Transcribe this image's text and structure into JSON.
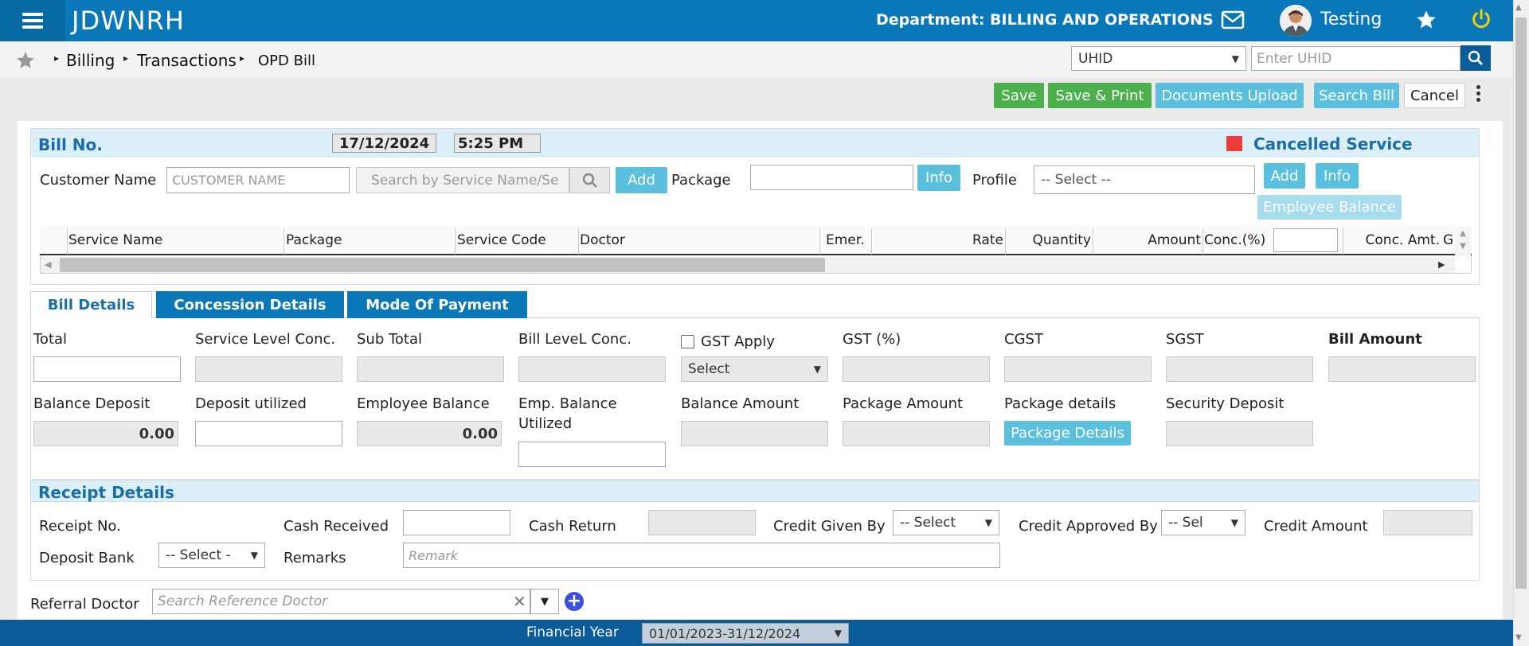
{
  "app": {
    "brand": "JDWNRH",
    "department_label": "Department: BILLING AND OPERATIONS",
    "user_name": "Testing"
  },
  "breadcrumb": {
    "items": [
      "Billing",
      "Transactions",
      "OPD Bill"
    ]
  },
  "search": {
    "type_selected": "UHID",
    "placeholder": "Enter UHID"
  },
  "actions": {
    "save": "Save",
    "save_print": "Save & Print",
    "documents_upload": "Documents Upload",
    "search_bill": "Search Bill",
    "cancel": "Cancel"
  },
  "bill_header": {
    "title": "Bill No.",
    "date": "17/12/2024",
    "time": "5:25 PM",
    "legend_label": "Cancelled Service",
    "legend_color": "#ee3b3b"
  },
  "customer_row": {
    "customer_label": "Customer Name",
    "customer_placeholder": "CUSTOMER NAME",
    "service_placeholder": "Search by Service Name/Se",
    "add_label": "Add",
    "package_label": "Package",
    "package_value": "",
    "info_label": "Info",
    "profile_label": "Profile",
    "profile_selected": "-- Select --",
    "add2_label": "Add",
    "info2_label": "Info",
    "employee_balance_label": "Employee Balance"
  },
  "services_table": {
    "columns": [
      "Service Name",
      "Package",
      "Service Code",
      "Doctor",
      "Emer.",
      "Rate",
      "Quantity",
      "Amount",
      "Conc.(%)",
      "Conc. Amt.",
      "G"
    ],
    "conc_input_value": ""
  },
  "tabs": [
    {
      "label": "Bill Details",
      "active": true
    },
    {
      "label": "Concession Details",
      "active": false
    },
    {
      "label": "Mode Of Payment",
      "active": false
    }
  ],
  "bill_details": {
    "total": "Total",
    "service_level_conc": "Service Level Conc.",
    "sub_total": "Sub Total",
    "bill_level_conc": "Bill LeveL Conc.",
    "gst_apply": "GST Apply",
    "gst_select": "Select",
    "gst_pct": "GST (%)",
    "cgst": "CGST",
    "sgst": "SGST",
    "bill_amount": "Bill Amount",
    "balance_deposit": "Balance Deposit",
    "balance_deposit_value": "0.00",
    "deposit_utilized": "Deposit utilized",
    "employee_balance": "Employee Balance",
    "employee_balance_value": "0.00",
    "emp_balance_utilized_1": "Emp. Balance",
    "emp_balance_utilized_2": "Utilized",
    "balance_amount": "Balance Amount",
    "package_amount": "Package Amount",
    "package_details": "Package details",
    "package_details_btn": "Package Details",
    "security_deposit": "Security Deposit"
  },
  "receipt": {
    "title": "Receipt Details",
    "receipt_no": "Receipt No.",
    "cash_received": "Cash Received",
    "cash_return": "Cash Return",
    "credit_given_by": "Credit Given By",
    "credit_given_select": "-- Select",
    "credit_approved_by": "Credit Approved By",
    "credit_approved_select": "-- Sel",
    "credit_amount": "Credit Amount",
    "deposit_bank": "Deposit Bank",
    "deposit_bank_select": "-- Select -",
    "remarks": "Remarks",
    "remarks_placeholder": "Remark"
  },
  "referral": {
    "label": "Referral Doctor",
    "placeholder": "Search Reference Doctor"
  },
  "footer": {
    "label": "Financial Year",
    "value": "01/01/2023-31/12/2024"
  },
  "colors": {
    "header_blue": "#0a78b8",
    "green": "#4cb14c",
    "light_blue": "#5bc0de",
    "footer_blue": "#0a5c99"
  }
}
